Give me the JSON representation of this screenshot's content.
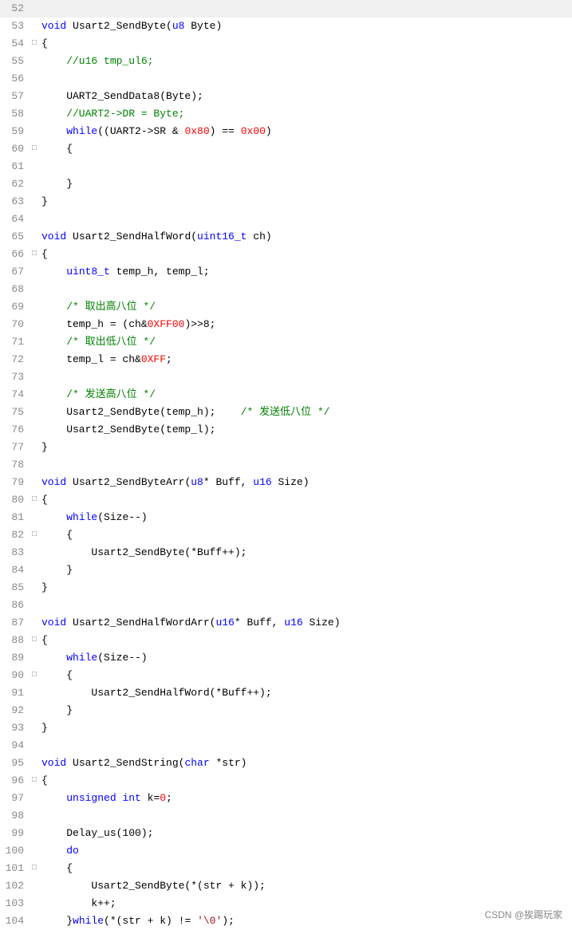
{
  "lines": [
    {
      "num": "52",
      "fold": "",
      "tokens": []
    },
    {
      "num": "53",
      "fold": "",
      "tokens": [
        {
          "t": "kw",
          "v": "void"
        },
        {
          "t": "plain",
          "v": " Usart2_SendByte("
        },
        {
          "t": "type",
          "v": "u8"
        },
        {
          "t": "plain",
          "v": " Byte)"
        }
      ]
    },
    {
      "num": "54",
      "fold": "□",
      "tokens": [
        {
          "t": "plain",
          "v": "{"
        }
      ]
    },
    {
      "num": "55",
      "fold": "",
      "tokens": [
        {
          "t": "comment",
          "v": "    //u16 tmp_ul6;"
        }
      ]
    },
    {
      "num": "56",
      "fold": "",
      "tokens": []
    },
    {
      "num": "57",
      "fold": "",
      "tokens": [
        {
          "t": "plain",
          "v": "    UART2_SendData8(Byte);"
        }
      ]
    },
    {
      "num": "58",
      "fold": "",
      "tokens": [
        {
          "t": "comment",
          "v": "    //UART2->DR = Byte;"
        }
      ]
    },
    {
      "num": "59",
      "fold": "",
      "tokens": [
        {
          "t": "plain",
          "v": "    "
        },
        {
          "t": "kw",
          "v": "while"
        },
        {
          "t": "plain",
          "v": "((UART2->SR & "
        },
        {
          "t": "hex",
          "v": "0x80"
        },
        {
          "t": "plain",
          "v": ") == "
        },
        {
          "t": "hex",
          "v": "0x00"
        },
        {
          "t": "plain",
          "v": ")"
        }
      ]
    },
    {
      "num": "60",
      "fold": "□",
      "tokens": [
        {
          "t": "plain",
          "v": "    {"
        }
      ]
    },
    {
      "num": "61",
      "fold": "",
      "tokens": []
    },
    {
      "num": "62",
      "fold": "",
      "tokens": [
        {
          "t": "plain",
          "v": "    }"
        }
      ]
    },
    {
      "num": "63",
      "fold": "",
      "tokens": [
        {
          "t": "plain",
          "v": "}"
        }
      ]
    },
    {
      "num": "64",
      "fold": "",
      "tokens": []
    },
    {
      "num": "65",
      "fold": "",
      "tokens": [
        {
          "t": "kw",
          "v": "void"
        },
        {
          "t": "plain",
          "v": " Usart2_SendHalfWord("
        },
        {
          "t": "type",
          "v": "uint16_t"
        },
        {
          "t": "plain",
          "v": " ch)"
        }
      ]
    },
    {
      "num": "66",
      "fold": "□",
      "tokens": [
        {
          "t": "plain",
          "v": "{"
        }
      ]
    },
    {
      "num": "67",
      "fold": "",
      "tokens": [
        {
          "t": "plain",
          "v": "    "
        },
        {
          "t": "type",
          "v": "uint8_t"
        },
        {
          "t": "plain",
          "v": " temp_h, temp_l;"
        }
      ]
    },
    {
      "num": "68",
      "fold": "",
      "tokens": []
    },
    {
      "num": "69",
      "fold": "",
      "tokens": [
        {
          "t": "comment-cn",
          "v": "    /* 取出高八位 */"
        }
      ]
    },
    {
      "num": "70",
      "fold": "",
      "tokens": [
        {
          "t": "plain",
          "v": "    temp_h = (ch&"
        },
        {
          "t": "hex",
          "v": "0XFF00"
        },
        {
          "t": "plain",
          "v": ")>>8;"
        }
      ]
    },
    {
      "num": "71",
      "fold": "",
      "tokens": [
        {
          "t": "comment-cn",
          "v": "    /* 取出低八位 */"
        }
      ]
    },
    {
      "num": "72",
      "fold": "",
      "tokens": [
        {
          "t": "plain",
          "v": "    temp_l = ch&"
        },
        {
          "t": "hex",
          "v": "0XFF"
        },
        {
          "t": "plain",
          "v": ";"
        }
      ]
    },
    {
      "num": "73",
      "fold": "",
      "tokens": []
    },
    {
      "num": "74",
      "fold": "",
      "tokens": [
        {
          "t": "comment-cn",
          "v": "    /* 发送高八位 */"
        }
      ]
    },
    {
      "num": "75",
      "fold": "",
      "tokens": [
        {
          "t": "plain",
          "v": "    Usart2_SendByte(temp_h);    "
        },
        {
          "t": "comment-cn",
          "v": "/* 发送低八位 */"
        }
      ]
    },
    {
      "num": "76",
      "fold": "",
      "tokens": [
        {
          "t": "plain",
          "v": "    Usart2_SendByte(temp_l);"
        }
      ]
    },
    {
      "num": "77",
      "fold": "",
      "tokens": [
        {
          "t": "plain",
          "v": "}"
        }
      ]
    },
    {
      "num": "78",
      "fold": "",
      "tokens": []
    },
    {
      "num": "79",
      "fold": "",
      "tokens": [
        {
          "t": "kw",
          "v": "void"
        },
        {
          "t": "plain",
          "v": " Usart2_SendByteArr("
        },
        {
          "t": "type",
          "v": "u8"
        },
        {
          "t": "plain",
          "v": "* Buff, "
        },
        {
          "t": "type",
          "v": "u16"
        },
        {
          "t": "plain",
          "v": " Size)"
        }
      ]
    },
    {
      "num": "80",
      "fold": "□",
      "tokens": [
        {
          "t": "plain",
          "v": "{"
        }
      ]
    },
    {
      "num": "81",
      "fold": "",
      "tokens": [
        {
          "t": "plain",
          "v": "    "
        },
        {
          "t": "kw",
          "v": "while"
        },
        {
          "t": "plain",
          "v": "(Size--)"
        }
      ]
    },
    {
      "num": "82",
      "fold": "□",
      "tokens": [
        {
          "t": "plain",
          "v": "    {"
        }
      ]
    },
    {
      "num": "83",
      "fold": "",
      "tokens": [
        {
          "t": "plain",
          "v": "        Usart2_SendByte(*Buff++);"
        }
      ]
    },
    {
      "num": "84",
      "fold": "",
      "tokens": [
        {
          "t": "plain",
          "v": "    }"
        }
      ]
    },
    {
      "num": "85",
      "fold": "",
      "tokens": [
        {
          "t": "plain",
          "v": "}"
        }
      ]
    },
    {
      "num": "86",
      "fold": "",
      "tokens": []
    },
    {
      "num": "87",
      "fold": "",
      "tokens": [
        {
          "t": "kw",
          "v": "void"
        },
        {
          "t": "plain",
          "v": " Usart2_SendHalfWordArr("
        },
        {
          "t": "type",
          "v": "u16"
        },
        {
          "t": "plain",
          "v": "* Buff, "
        },
        {
          "t": "type",
          "v": "u16"
        },
        {
          "t": "plain",
          "v": " Size)"
        }
      ]
    },
    {
      "num": "88",
      "fold": "□",
      "tokens": [
        {
          "t": "plain",
          "v": "{"
        }
      ]
    },
    {
      "num": "89",
      "fold": "",
      "tokens": [
        {
          "t": "plain",
          "v": "    "
        },
        {
          "t": "kw",
          "v": "while"
        },
        {
          "t": "plain",
          "v": "(Size--)"
        }
      ]
    },
    {
      "num": "90",
      "fold": "□",
      "tokens": [
        {
          "t": "plain",
          "v": "    {"
        }
      ]
    },
    {
      "num": "91",
      "fold": "",
      "tokens": [
        {
          "t": "plain",
          "v": "        Usart2_SendHalfWord(*Buff++);"
        }
      ]
    },
    {
      "num": "92",
      "fold": "",
      "tokens": [
        {
          "t": "plain",
          "v": "    }"
        }
      ]
    },
    {
      "num": "93",
      "fold": "",
      "tokens": [
        {
          "t": "plain",
          "v": "}"
        }
      ]
    },
    {
      "num": "94",
      "fold": "",
      "tokens": []
    },
    {
      "num": "95",
      "fold": "",
      "tokens": [
        {
          "t": "kw",
          "v": "void"
        },
        {
          "t": "plain",
          "v": " Usart2_SendString("
        },
        {
          "t": "type",
          "v": "char"
        },
        {
          "t": "plain",
          "v": " *str)"
        }
      ]
    },
    {
      "num": "96",
      "fold": "□",
      "tokens": [
        {
          "t": "plain",
          "v": "{"
        }
      ]
    },
    {
      "num": "97",
      "fold": "",
      "tokens": [
        {
          "t": "plain",
          "v": "    "
        },
        {
          "t": "kw",
          "v": "unsigned"
        },
        {
          "t": "plain",
          "v": " "
        },
        {
          "t": "type",
          "v": "int"
        },
        {
          "t": "plain",
          "v": " k="
        },
        {
          "t": "hex",
          "v": "0"
        },
        {
          "t": "plain",
          "v": ";"
        }
      ]
    },
    {
      "num": "98",
      "fold": "",
      "tokens": []
    },
    {
      "num": "99",
      "fold": "",
      "tokens": [
        {
          "t": "plain",
          "v": "    Delay_us(100);"
        }
      ]
    },
    {
      "num": "100",
      "fold": "",
      "tokens": [
        {
          "t": "plain",
          "v": "    "
        },
        {
          "t": "kw",
          "v": "do"
        }
      ]
    },
    {
      "num": "101",
      "fold": "□",
      "tokens": [
        {
          "t": "plain",
          "v": "    {"
        }
      ]
    },
    {
      "num": "102",
      "fold": "",
      "tokens": [
        {
          "t": "plain",
          "v": "        Usart2_SendByte(*(str + k));"
        }
      ]
    },
    {
      "num": "103",
      "fold": "",
      "tokens": [
        {
          "t": "plain",
          "v": "        k++;"
        }
      ]
    },
    {
      "num": "104",
      "fold": "",
      "tokens": [
        {
          "t": "plain",
          "v": "    }"
        },
        {
          "t": "kw",
          "v": "while"
        },
        {
          "t": "plain",
          "v": "(*(str + k) != "
        },
        {
          "t": "string",
          "v": "'\\0'"
        },
        {
          "t": "plain",
          "v": ");"
        }
      ]
    }
  ],
  "branding": "CSDN @挨踢玩家"
}
